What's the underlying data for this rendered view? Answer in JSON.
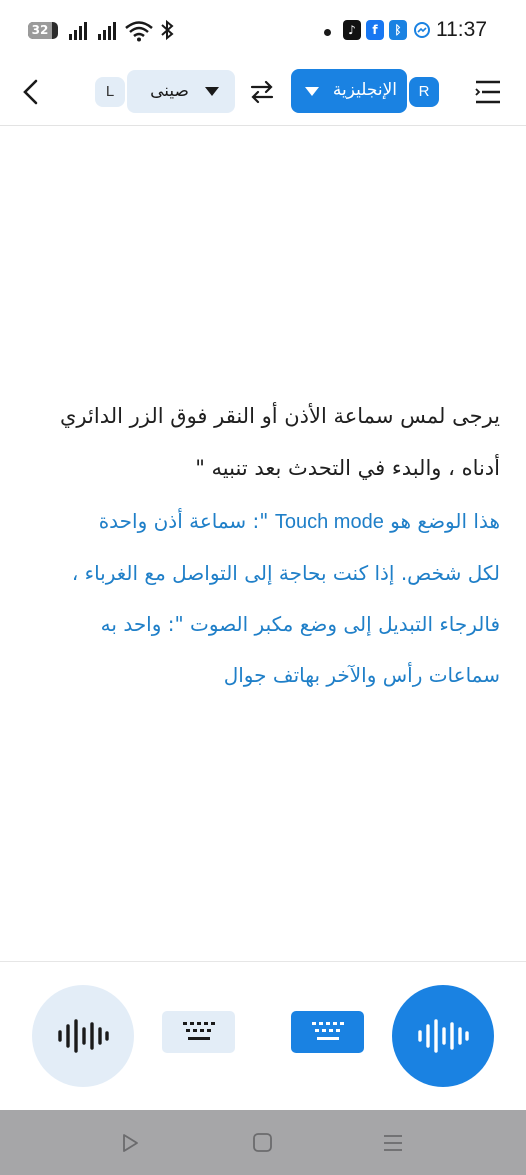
{
  "status_bar": {
    "battery_level": "32",
    "time": "11:37",
    "icons": [
      "battery-icon",
      "signal-icon",
      "signal-icon",
      "wifi-icon",
      "bluetooth-icon",
      "notification-dot-icon",
      "tiktok-icon",
      "facebook-icon",
      "bluetooth-icon",
      "messenger-icon"
    ]
  },
  "toolbar": {
    "back_icon": "chevron-left-icon",
    "left_badge": "L",
    "left_language": "صينى",
    "swap_icon": "swap-arrows-icon",
    "right_language": "الإنجليزية",
    "right_badge": "R",
    "menu_icon": "menu-icon"
  },
  "content": {
    "instruction_lines": [
      "يرجى لمس سماعة الأذن أو النقر فوق الزر الدائري",
      "أدناه ، والبدء في التحدث بعد  تنبيه \""
    ],
    "mode_lines": [
      {
        "before": "هذا الوضع هو ",
        "ltr": "Touch mode",
        "after": " \": سماعة أذن واحدة"
      },
      {
        "before": "لكل شخص. إذا كنت بحاجة إلى التواصل مع الغرباء ،",
        "ltr": "",
        "after": ""
      },
      {
        "before": "فالرجاء التبديل إلى  وضع مكبر الصوت \": واحد به",
        "ltr": "",
        "after": ""
      },
      {
        "before": "سماعات رأس والآخر بهاتف جوال",
        "ltr": "",
        "after": ""
      }
    ]
  },
  "controls": {
    "left_mic_icon": "voice-wave-icon",
    "left_keyboard_icon": "keyboard-icon",
    "right_keyboard_icon": "keyboard-icon",
    "right_mic_icon": "voice-wave-icon"
  },
  "nav_bar": {
    "icons": [
      "back-triangle-icon",
      "home-square-icon",
      "recent-apps-icon"
    ]
  },
  "colors": {
    "accent": "#1a82e2",
    "accent_light": "#e3edf7",
    "mode_text": "#1f7fc8",
    "nav_bar": "#a6a6a8"
  }
}
